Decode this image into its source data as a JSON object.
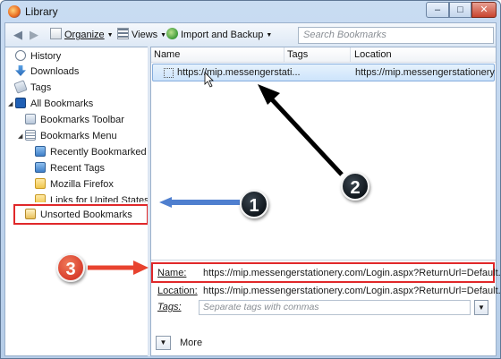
{
  "window": {
    "title": "Library",
    "minimize_symbol": "–",
    "maximize_symbol": "□",
    "close_symbol": "✕"
  },
  "toolbar": {
    "back_symbol": "◀",
    "forward_symbol": "▶",
    "organize_label": "Organize",
    "views_label": "Views",
    "import_label": "Import and Backup",
    "search_placeholder": "Search Bookmarks"
  },
  "sidebar": {
    "items": [
      {
        "label": "History",
        "icon": "history-icon"
      },
      {
        "label": "Downloads",
        "icon": "download-icon"
      },
      {
        "label": "Tags",
        "icon": "tag-icon"
      },
      {
        "label": "All Bookmarks",
        "icon": "bookmarks-star-icon"
      },
      {
        "label": "Bookmarks Toolbar",
        "icon": "toolbar-folder-icon"
      },
      {
        "label": "Bookmarks Menu",
        "icon": "menu-folder-icon"
      },
      {
        "label": "Recently Bookmarked",
        "icon": "smart-folder-icon"
      },
      {
        "label": "Recent Tags",
        "icon": "smart-folder-icon"
      },
      {
        "label": "Mozilla Firefox",
        "icon": "folder-icon"
      },
      {
        "label": "Links for United States",
        "icon": "folder-icon"
      },
      {
        "label": "Unsorted Bookmarks",
        "icon": "unsorted-folder-icon"
      }
    ]
  },
  "list": {
    "columns": [
      "Name",
      "Tags",
      "Location"
    ],
    "rows": [
      {
        "name": "https://mip.messengerstati...",
        "tags": "",
        "location": "https://mip.messengerstationery.co..."
      }
    ]
  },
  "details": {
    "name_label": "Name:",
    "name_value": "https://mip.messengerstationery.com/Login.aspx?ReturnUrl=Default.aspx",
    "location_label": "Location:",
    "location_value": "https://mip.messengerstationery.com/Login.aspx?ReturnUrl=Default.aspx",
    "tags_label": "Tags:",
    "tags_placeholder": "Separate tags with commas",
    "more_label": "More"
  },
  "annotations": [
    {
      "number": "1",
      "color": "#1e2833"
    },
    {
      "number": "2",
      "color": "#1e2833"
    },
    {
      "number": "3",
      "color": "#d63a2a"
    }
  ],
  "colors": {
    "highlight_red": "#e0282a",
    "arrow_blue": "#4f7fcf",
    "arrow_black": "#000000",
    "arrow_red": "#e8432f"
  }
}
